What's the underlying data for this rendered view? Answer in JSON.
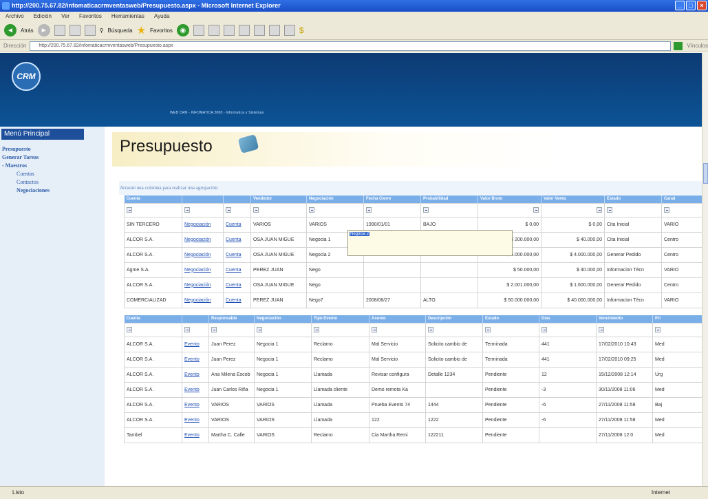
{
  "window": {
    "title": "http://200.75.67.82/infomaticacrmventasweb/Presupuesto.aspx - Microsoft Internet Explorer",
    "menus": [
      "Archivo",
      "Edición",
      "Ver",
      "Favoritos",
      "Herramientas",
      "Ayuda"
    ]
  },
  "toolbar": {
    "back_label": "Atrás",
    "search_label": "Búsqueda",
    "favorites_label": "Favoritos"
  },
  "address": {
    "label": "Dirección",
    "url": "http://200.75.67.82/infomaticacrmventasweb/Presupuesto.aspx",
    "links": "Vínculos"
  },
  "status": {
    "left": "Listo",
    "zone": "Internet"
  },
  "banner": {
    "logo": "CRM",
    "subtitle": "WEB CRM - INFOMATICA 2008 - Informatica y Sistemas"
  },
  "sidebar": {
    "title": "Menú Principal",
    "items": [
      {
        "label": "Presupuesto",
        "bold": true
      },
      {
        "label": "Generar Tareas",
        "bold": true
      },
      {
        "label": "- Maestros",
        "bold": true
      },
      {
        "label": "Cuentas",
        "bold": false
      },
      {
        "label": "Contactos",
        "bold": false
      },
      {
        "label": "Negociaciones",
        "bold": true
      }
    ]
  },
  "page_title": "Presupuesto",
  "group_hint": "Arrastre una columna para realizar una agrupación.",
  "grid1": {
    "headers": [
      "Cuenta",
      "",
      "",
      "Vendedor",
      "Negociación",
      "Fecha Cierre",
      "Probabilidad",
      "Valor Bruto",
      "Valor Venta",
      "Estado",
      "Canal"
    ],
    "rows": [
      [
        "SIN TERCERO",
        "Negociación",
        "Cuenta",
        "VARIOS",
        "VARIOS",
        "1990/01/01",
        "BAJO",
        "$ 0,00",
        "$ 0,00",
        "Cita Inicial",
        "VARIO"
      ],
      [
        "ALCOR S.A.",
        "Negociación",
        "Cuenta",
        "OSA JUAN MIGUE",
        "Negocia 1",
        "2008/08/26",
        "BAJO",
        "$ 200.000,00",
        "$ 40.000,00",
        "Cita Inicial",
        "Centro"
      ],
      [
        "ALCOR S.A.",
        "Negociación",
        "Cuenta",
        "OSA JUAN MIGUE",
        "Negocia 2",
        "2008/08/26",
        "ALTO",
        "$ 5.000.000,00",
        "$ 4.000.000,00",
        "Generar Pedido",
        "Centro"
      ],
      [
        "Agme S.A.",
        "Negociación",
        "Cuenta",
        "PEREZ JUAN",
        "Nego",
        "",
        "",
        "$ 50.000,00",
        "$ 40.000,00",
        "Informacion Técn",
        "VARIO"
      ],
      [
        "ALCOR S.A.",
        "Negociación",
        "Cuenta",
        "OSA JUAN MIGUE",
        "Nego",
        "",
        "",
        "$ 2.001.000,00",
        "$ 1.600.000,00",
        "Generar Pedido",
        "Centro"
      ],
      [
        "COMERCIALIZAD",
        "Negociación",
        "Cuenta",
        "PEREZ JUAN",
        "Nego7",
        "2008/08/27",
        "ALTO",
        "$ 50.000.000,00",
        "$ 40.000.000,00",
        "Informacion Técn",
        "VARIO"
      ]
    ],
    "tooltip": "Negocia 2"
  },
  "grid2": {
    "headers": [
      "Cuenta",
      "",
      "Responsable",
      "Negociación",
      "Tipo Evento",
      "Asunto",
      "Descripción",
      "Estado",
      "Días",
      "Vencimiento",
      "Pri"
    ],
    "rows": [
      [
        "ALCOR S.A.",
        "Evento",
        "Juan Perez",
        "Negocia 1",
        "Reclamo",
        "Mal Servicio",
        "Solicito cambio de",
        "Terminada",
        "441",
        "17/02/2010 10:43",
        "Med"
      ],
      [
        "ALCOR S.A.",
        "Evento",
        "Juan Perez",
        "Negocia 1",
        "Reclamo",
        "Mal Servicio",
        "Solicito cambio de",
        "Terminada",
        "441",
        "17/02/2010 09:25",
        "Med"
      ],
      [
        "ALCOR S.A.",
        "Evento",
        "Ana Milena Escob",
        "Negocia 1",
        "Llamada",
        "Revisar configura",
        "Detalle 1234",
        "Pendiente",
        "12",
        "15/12/2008 12:14",
        "Urg"
      ],
      [
        "ALCOR S.A.",
        "Evento",
        "Juan Carlos Riña",
        "Negocia 1",
        "Llamada cliente",
        "Demo remota Ka",
        "",
        "Pendiente",
        "-3",
        "30/11/2008 11:06",
        "Med"
      ],
      [
        "ALCOR S.A.",
        "Evento",
        "VARIOS",
        "VARIOS",
        "Llamada",
        "Prueba Evento 74",
        "1444",
        "Pendiente",
        "-6",
        "27/11/2008 11:58",
        "Baj"
      ],
      [
        "ALCOR S.A.",
        "Evento",
        "VARIOS",
        "VARIOS",
        "Llamada",
        "122",
        "1222",
        "Pendiente",
        "-6",
        "27/11/2008 11:58",
        "Med"
      ],
      [
        "Tambel",
        "Evento",
        "Martha C. Calle",
        "VARIOS",
        "Reclamo",
        "Cia Martha Remi",
        "122211",
        "Pendiente",
        "",
        "27/11/2008 12:0",
        "Med"
      ]
    ]
  }
}
